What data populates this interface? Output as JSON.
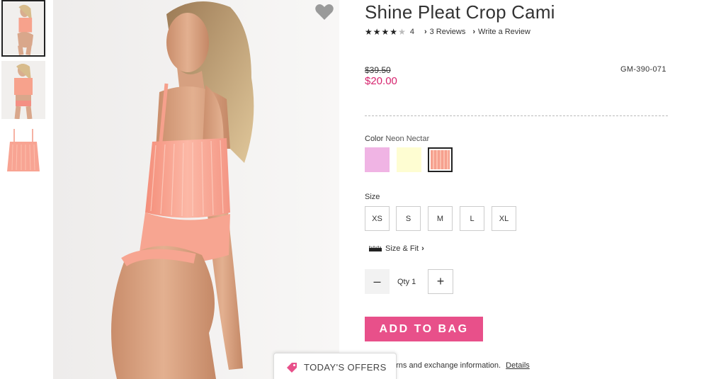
{
  "product": {
    "title": "Shine Pleat Crop Cami",
    "rating_value": "4",
    "reviews_link": "3 Reviews",
    "write_review_link": "Write a Review",
    "original_price": "$39.50",
    "sale_price": "$20.00",
    "sku": "GM-390-071"
  },
  "color": {
    "label": "Color",
    "selected_name": "Neon Nectar",
    "swatches": [
      "lavender-pink",
      "pale-yellow",
      "neon-nectar"
    ]
  },
  "size": {
    "label": "Size",
    "options": [
      "XS",
      "S",
      "M",
      "L",
      "XL"
    ],
    "size_fit_link": "Size & Fit"
  },
  "quantity": {
    "minus": "–",
    "label": "Qty 1",
    "plus": "+"
  },
  "actions": {
    "add_to_bag": "ADD TO BAG"
  },
  "returns": {
    "text": "urns and exchange information.",
    "details_link": "Details"
  },
  "offers_tab": {
    "label": "TODAY'S OFFERS"
  },
  "colors": {
    "sale": "#d6246e",
    "button": "#e8508a",
    "swatch_lavender": "#f0b4e4",
    "swatch_yellow": "#fefdd2",
    "swatch_nectar": "#f6a08e"
  }
}
